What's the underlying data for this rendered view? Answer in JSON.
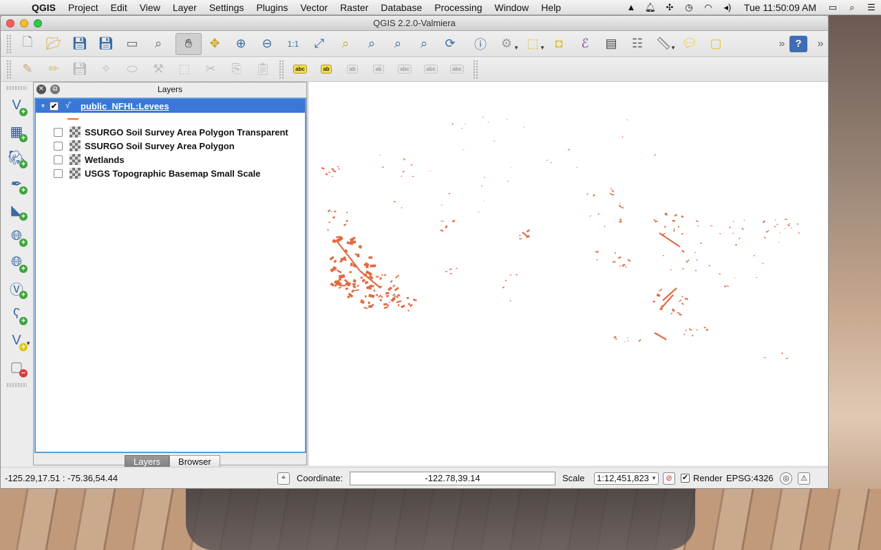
{
  "menubar": {
    "apple_icon": "apple-icon",
    "app_name": "QGIS",
    "menus": [
      "Project",
      "Edit",
      "View",
      "Layer",
      "Settings",
      "Plugins",
      "Vector",
      "Raster",
      "Database",
      "Processing",
      "Window",
      "Help"
    ],
    "clock": "Tue 11:50:09 AM",
    "status_icons": [
      "google-drive-icon",
      "notification-icon",
      "bluetooth-icon",
      "time-machine-icon",
      "wifi-icon",
      "volume-icon"
    ]
  },
  "window": {
    "title": "QGIS 2.2.0-Valmiera"
  },
  "toolbar1": {
    "icons": [
      "new-project-icon",
      "open-project-icon",
      "save-project-icon",
      "save-as-icon",
      "new-print-composer-icon",
      "composer-manager-icon",
      "pan-icon",
      "pan-to-selection-icon",
      "zoom-in-icon",
      "zoom-out-icon",
      "zoom-native-icon",
      "zoom-full-icon",
      "zoom-to-selection-icon",
      "zoom-to-layer-icon",
      "zoom-last-icon",
      "zoom-next-icon",
      "refresh-icon",
      "identify-icon",
      "action-icon",
      "select-features-icon",
      "deselect-icon",
      "field-calculator-icon",
      "attribute-table-icon",
      "statistics-icon",
      "measure-icon",
      "map-tips-icon",
      "new-annotation-icon"
    ]
  },
  "toolbar2": {
    "labels": [
      "abc",
      "ab",
      "ab",
      "ab",
      "abc",
      "abc",
      "abc"
    ]
  },
  "layers_panel": {
    "title": "Layers",
    "layers": [
      {
        "name": "public_NFHL:Levees",
        "checked": true,
        "selected": true,
        "type": "vector"
      },
      {
        "name": "SSURGO Soil Survey Area Polygon Transparent",
        "checked": false,
        "selected": false,
        "type": "raster"
      },
      {
        "name": "SSURGO Soil Survey Area Polygon",
        "checked": false,
        "selected": false,
        "type": "raster"
      },
      {
        "name": "Wetlands",
        "checked": false,
        "selected": false,
        "type": "raster"
      },
      {
        "name": "USGS Topographic Basemap Small Scale",
        "checked": false,
        "selected": false,
        "type": "raster"
      }
    ],
    "tabs": [
      "Layers",
      "Browser"
    ],
    "active_tab": "Layers"
  },
  "map": {
    "feature_color": "#e06b42"
  },
  "statusbar": {
    "extent": "-125.29,17.51 : -75.36,54.44",
    "coordinate_label": "Coordinate:",
    "coordinate_value": "-122.78,39.14",
    "scale_label": "Scale",
    "scale_value": "1:12,451,823",
    "render_label": "Render",
    "render_checked": true,
    "crs": "EPSG:4326"
  }
}
